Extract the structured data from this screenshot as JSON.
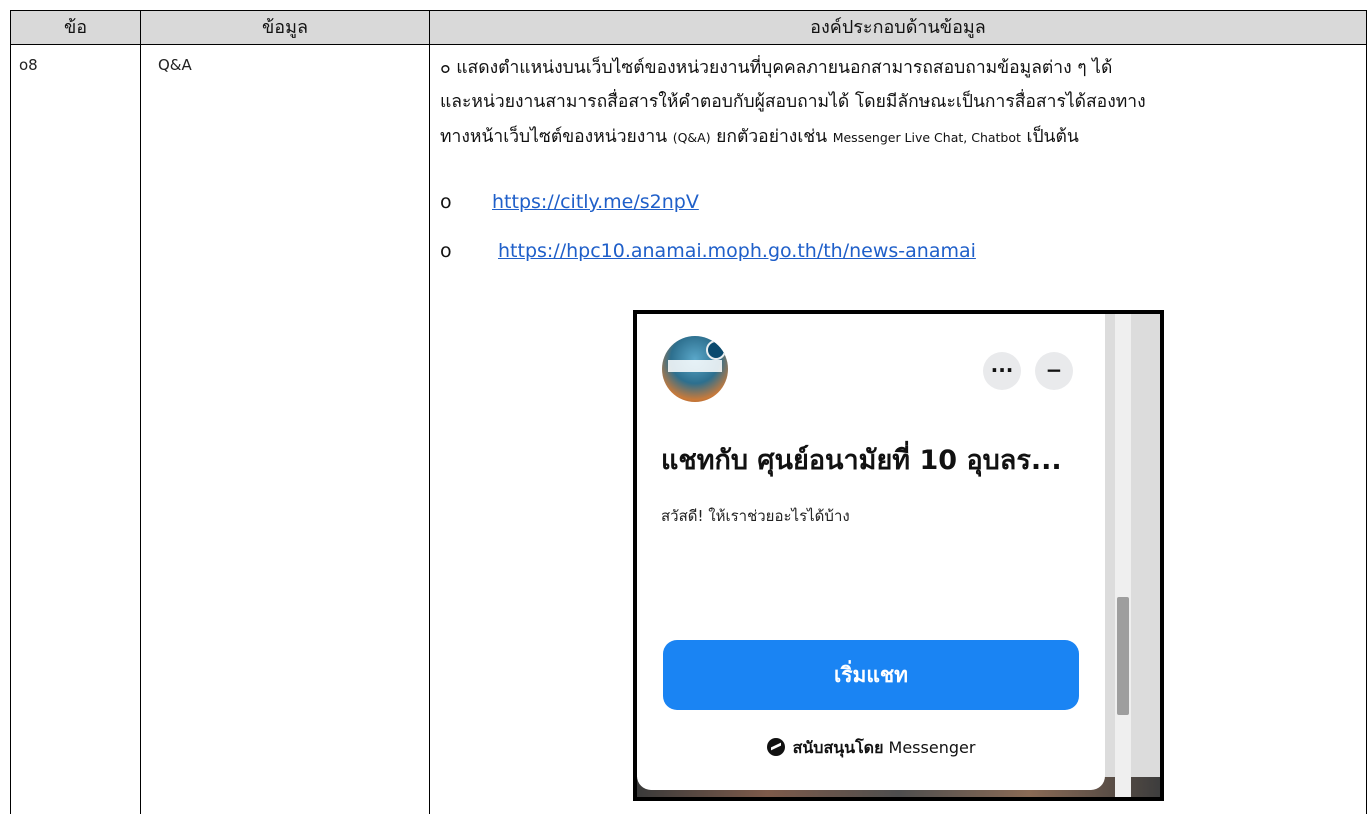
{
  "table": {
    "headers": [
      "ข้อ",
      "ข้อมูล",
      "องค์ประกอบด้านข้อมูล"
    ],
    "row": {
      "number": "o8",
      "item": "Q&A",
      "description_lines": [
        "๐ แสดงตำแหน่งบนเว็บไซต์ของหน่วยงานที่บุคคลภายนอกสามารถสอบถามข้อมูลต่าง ๆ ได้",
        "และหน่วยงานสามารถสื่อสารให้คำตอบกับผู้สอบถามได้ โดยมีลักษณะเป็นการสื่อสารได้สองทาง"
      ],
      "description_line3_prefix": "ทางหน้าเว็บไซต์ของหน่วยงาน ",
      "description_line3_small1": "(Q&A)",
      "description_line3_mid": " ยกตัวอย่างเช่น ",
      "description_line3_small2": "Messenger Live Chat, Chatbot",
      "description_line3_suffix": " เป็นต้น",
      "links": [
        {
          "bullet": "o",
          "url": "https://citly.me/s2npV"
        },
        {
          "bullet": "o",
          "url": "https://hpc10.anamai.moph.go.th/th/news-anamai"
        }
      ]
    }
  },
  "chat_widget": {
    "more_icon_glyph": "···",
    "minimize_icon_glyph": "−",
    "title": "แชทกับ ศุนย์อนามัยที่ 10 อุบลร...",
    "greeting": "สวัสดี! ให้เราช่วยอะไรได้บ้าง",
    "start_button": "เริ่มแชท",
    "powered_by_label": "สนับสนุนโดย",
    "powered_by_brand": "Messenger",
    "accent_color": "#1a84f3"
  }
}
